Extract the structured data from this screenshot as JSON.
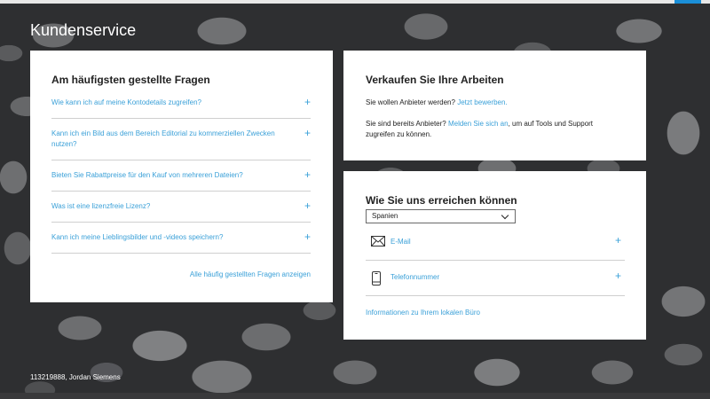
{
  "page": {
    "title": "Kundenservice"
  },
  "faq": {
    "heading": "Am häufigsten gestellte Fragen",
    "items": [
      {
        "question": "Wie kann ich auf meine Kontodetails zugreifen?",
        "toggle": "+"
      },
      {
        "question": "Kann ich ein Bild aus dem Bereich Editorial zu kommerziellen Zwecken nutzen?",
        "toggle": "+"
      },
      {
        "question": "Bieten Sie Rabattpreise für den Kauf von mehreren Dateien?",
        "toggle": "+"
      },
      {
        "question": "Was ist eine lizenzfreie Lizenz?",
        "toggle": "+"
      },
      {
        "question": "Kann ich meine Lieblingsbilder und -videos speichern?",
        "toggle": "+"
      }
    ],
    "show_all_link": "Alle häufig gestellten Fragen anzeigen"
  },
  "sell": {
    "heading": "Verkaufen Sie Ihre Arbeiten",
    "line1_text": "Sie wollen Anbieter werden?",
    "line1_link": "Jetzt bewerben.",
    "line2_text_before": "Sie sind bereits Anbieter?",
    "line2_link": "Melden Sie sich an",
    "line2_text_after": ", um auf Tools und Support zugreifen zu können."
  },
  "contact": {
    "heading": "Wie Sie uns erreichen können",
    "country_selected": "Spanien",
    "email_label": "E-Mail",
    "email_toggle": "+",
    "phone_label": "Telefonnummer",
    "phone_toggle": "+",
    "office_link": "Informationen zu Ihrem lokalen Büro"
  },
  "footer": {
    "image_credit": "113219888, Jordan Siemens"
  },
  "colors": {
    "link": "#3aa0d8",
    "card": "#ffffff",
    "divider": "#cfcfcf"
  }
}
